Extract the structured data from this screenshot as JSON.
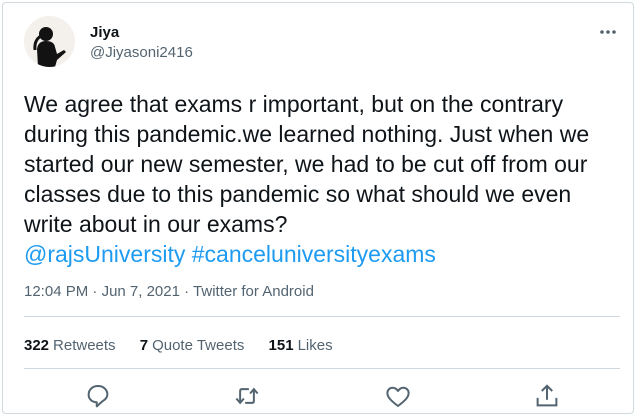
{
  "user": {
    "name": "Jiya",
    "handle": "@Jiyasoni2416",
    "avatar_icon": "avatar-silhouette"
  },
  "more_icon": "more-horizontal-icon",
  "tweet": {
    "text": "We agree that exams r important, but on the contrary during this pandemic.we learned nothing. Just when we started our new semester, we had to be cut off from our classes due to this pandemic so what should we even write about in our exams?",
    "mention": "@rajsUniversity",
    "hashtag": "#canceluniversityexams"
  },
  "meta": {
    "time": "12:04 PM",
    "separator": " · ",
    "date": "Jun 7, 2021",
    "source": "Twitter for Android"
  },
  "stats": {
    "retweets_count": "322",
    "retweets_label": "Retweets",
    "quotes_count": "7",
    "quotes_label": "Quote Tweets",
    "likes_count": "151",
    "likes_label": "Likes"
  },
  "actions": [
    "reply-icon",
    "retweet-icon",
    "like-icon",
    "share-icon"
  ],
  "colors": {
    "link": "#1d9bf0",
    "secondary_text": "#536471",
    "primary_text": "#0f1419",
    "border": "#cfd9de"
  }
}
